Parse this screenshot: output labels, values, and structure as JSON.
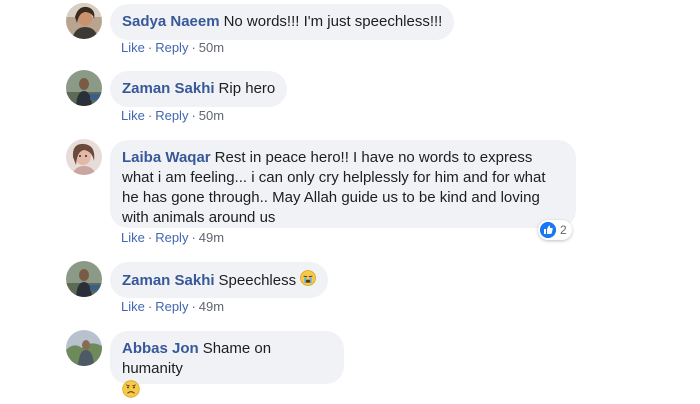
{
  "actions": {
    "like_label": "Like",
    "reply_label": "Reply",
    "separator": "·"
  },
  "comments": [
    {
      "author": "Sadya Naeem",
      "text": "No words!!! I'm just speechless!!!",
      "time": "50m",
      "avatar_icon": "profile-photo"
    },
    {
      "author": "Zaman Sakhi",
      "text": "Rip hero",
      "time": "50m",
      "avatar_icon": "profile-photo"
    },
    {
      "author": "Laiba Waqar",
      "text": "Rest in peace hero!! I have no words to express what i am feeling... i can only cry helplessly for him and for what he has gone through.. May Allah guide us to be kind and loving with animals around us",
      "time": "49m",
      "reaction_count": "2",
      "reaction_icon": "like-thumbs-up",
      "avatar_icon": "profile-photo"
    },
    {
      "author": "Zaman Sakhi",
      "text": "Speechless",
      "time": "49m",
      "emoji": "crying-face",
      "avatar_icon": "profile-photo"
    },
    {
      "author": "Abbas Jon",
      "text": "Shame on humanity",
      "emoji": "sad-face",
      "avatar_icon": "profile-photo"
    }
  ],
  "colors": {
    "author": "#385898",
    "link": "#4267b2",
    "bubble": "#f0f2f5",
    "like_blue": "#1877f2"
  }
}
